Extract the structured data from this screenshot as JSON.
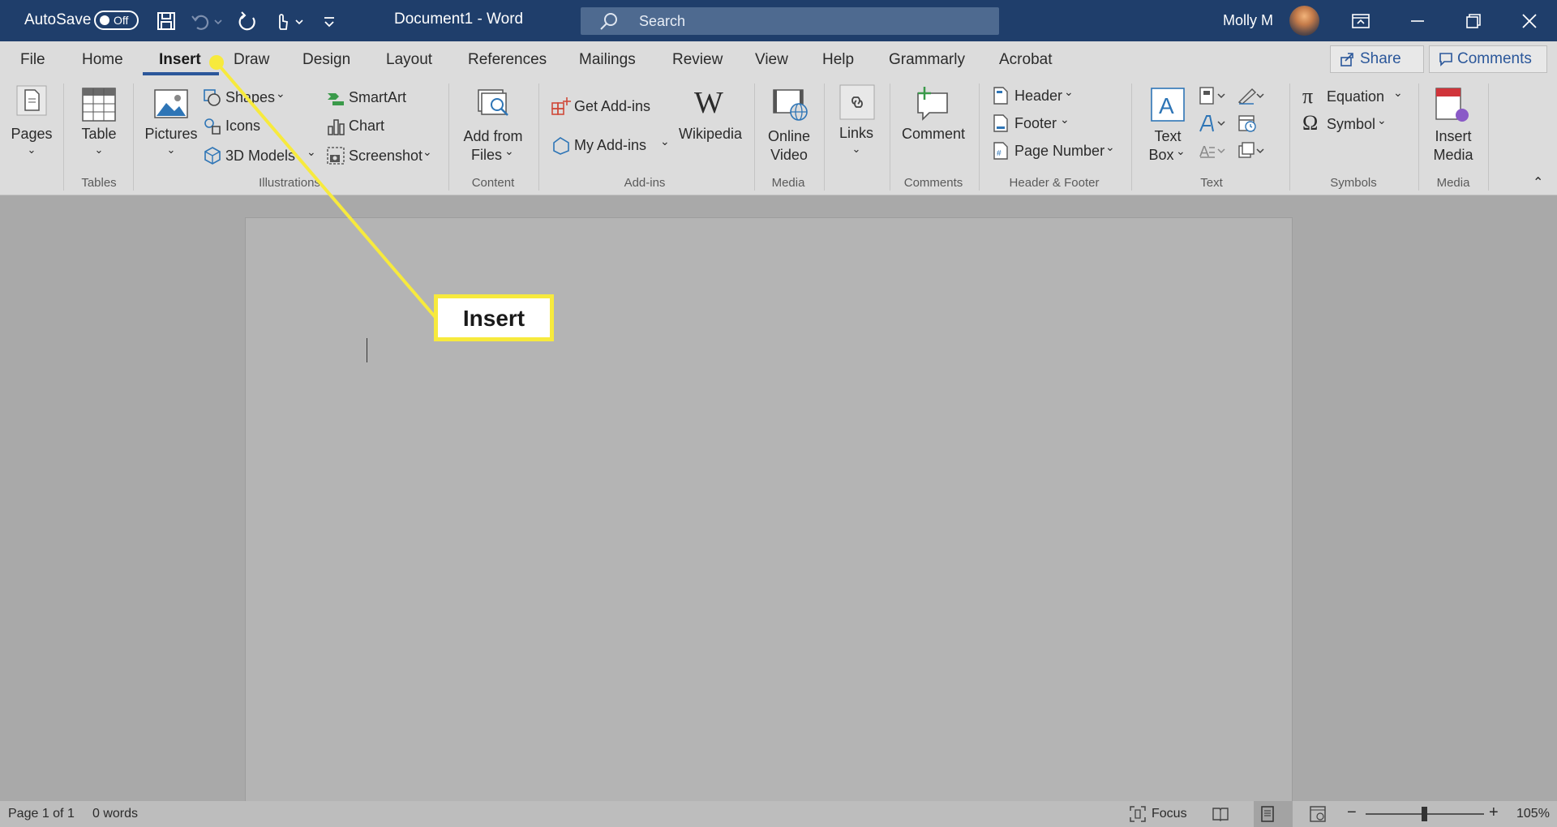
{
  "titlebar": {
    "autosave_label": "AutoSave",
    "autosave_state": "Off",
    "document_title": "Document1  -  Word",
    "search_placeholder": "Search",
    "user_name": "Molly M"
  },
  "tabs": [
    "File",
    "Home",
    "Insert",
    "Draw",
    "Design",
    "Layout",
    "References",
    "Mailings",
    "Review",
    "View",
    "Help",
    "Grammarly",
    "Acrobat"
  ],
  "active_tab": "Insert",
  "share_label": "Share",
  "comments_label": "Comments",
  "ribbon": {
    "pages": "Pages",
    "table": "Table",
    "tables_group": "Tables",
    "pictures": "Pictures",
    "shapes": "Shapes",
    "icons": "Icons",
    "models3d": "3D Models",
    "smartart": "SmartArt",
    "chart": "Chart",
    "screenshot": "Screenshot",
    "illustrations_group": "Illustrations",
    "add_from_files_1": "Add from",
    "add_from_files_2": "Files",
    "content_group": "Content",
    "get_addins": "Get Add-ins",
    "my_addins": "My Add-ins",
    "wikipedia": "Wikipedia",
    "addins_group": "Add-ins",
    "online_video_1": "Online",
    "online_video_2": "Video",
    "media_group": "Media",
    "links": "Links",
    "comment": "Comment",
    "comments_group": "Comments",
    "header": "Header",
    "footer": "Footer",
    "page_number": "Page Number",
    "header_footer_group": "Header & Footer",
    "text_box_1": "Text",
    "text_box_2": "Box",
    "text_group": "Text",
    "equation": "Equation",
    "symbol": "Symbol",
    "symbols_group": "Symbols",
    "insert_media_1": "Insert",
    "insert_media_2": "Media",
    "media_group_2": "Media"
  },
  "callout_label": "Insert",
  "status": {
    "page": "Page 1 of 1",
    "words": "0 words",
    "focus": "Focus",
    "zoom": "105%"
  },
  "colors": {
    "titlebar": "#1f3e6b",
    "accent": "#2b579a",
    "callout": "#f7ea3d"
  }
}
